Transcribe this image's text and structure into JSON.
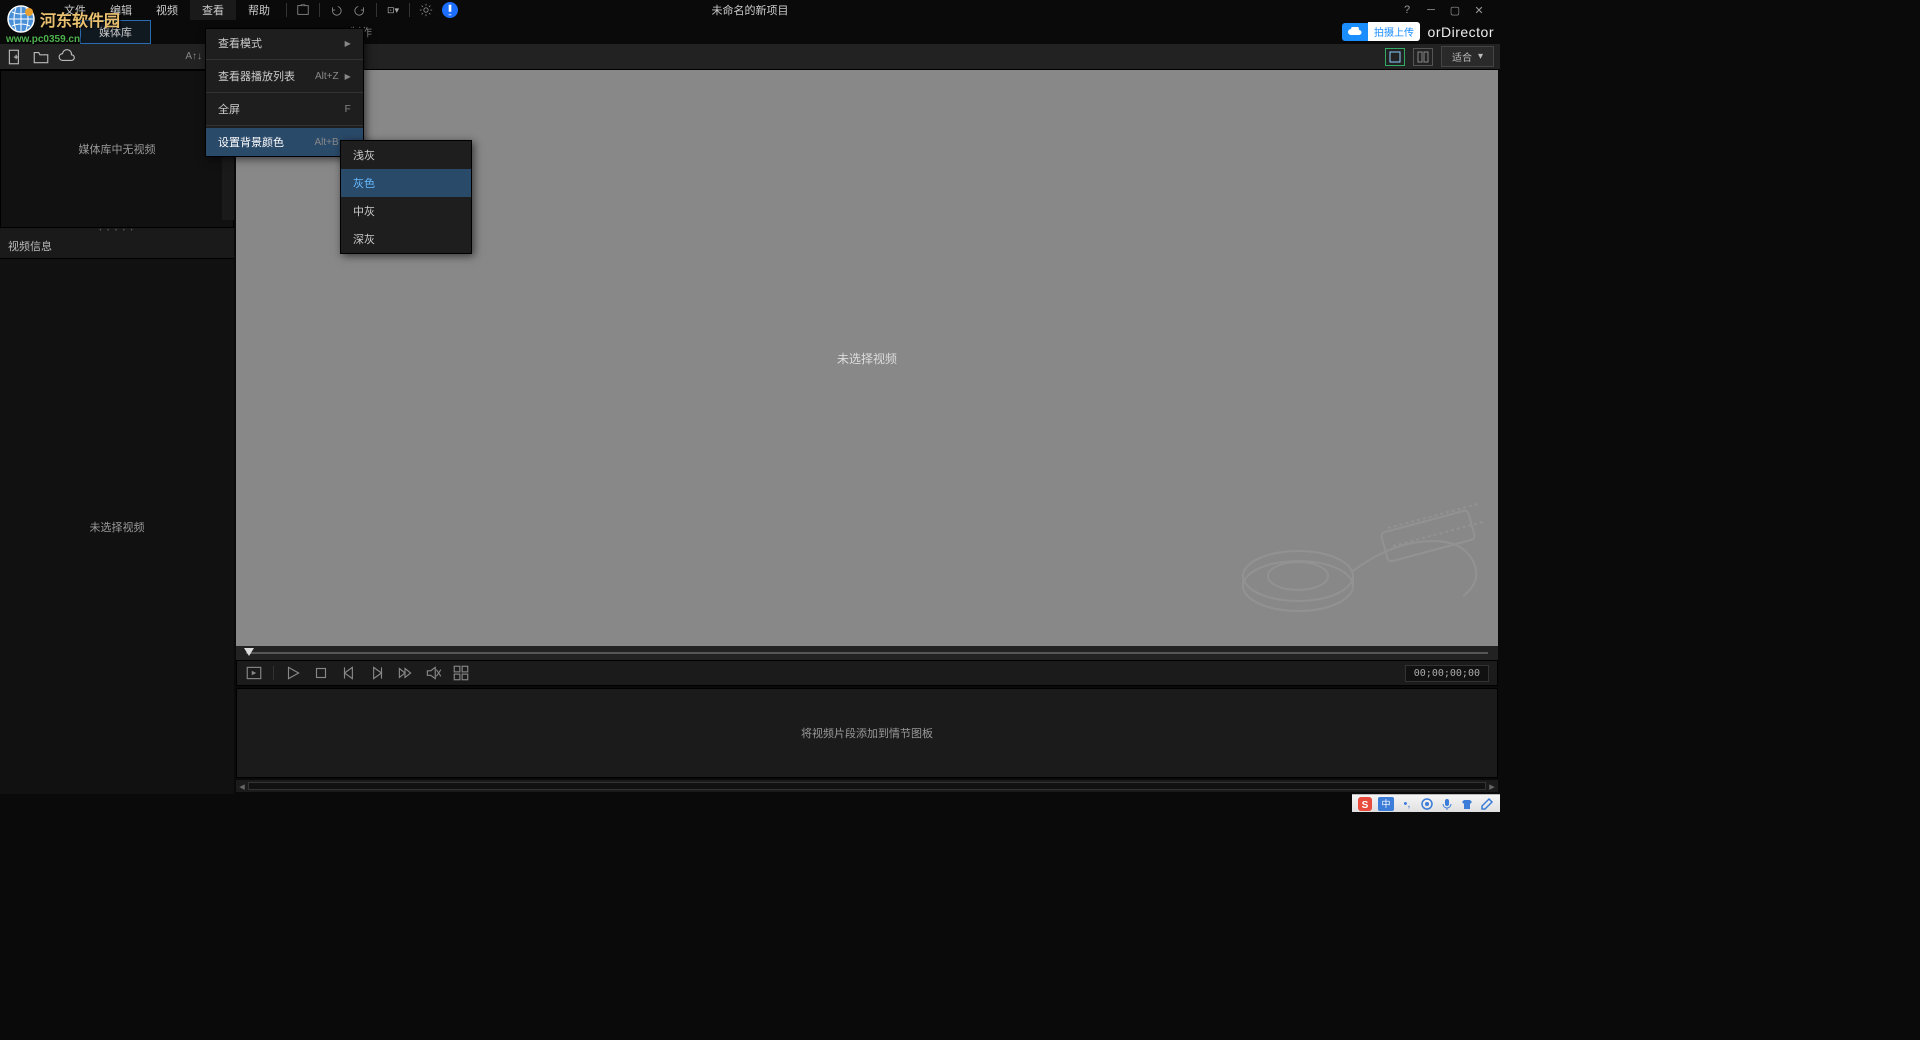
{
  "watermark": {
    "site_name": "河东软件园",
    "url": "www.pc0359.cn"
  },
  "menubar": {
    "items": [
      "文件",
      "编辑",
      "视频",
      "查看",
      "帮助"
    ],
    "title": "未命名的新项目",
    "help_icon": "?"
  },
  "tabs": {
    "media": "媒体库",
    "production": "制作"
  },
  "upload": {
    "label": "拍摄上传"
  },
  "brand": "orDirector",
  "sec_toolbar": {
    "sort_label": "A↑↓",
    "zoom_label": "适合"
  },
  "left_panel": {
    "media_empty": "媒体库中无视频",
    "info_header": "视频信息",
    "info_empty": "未选择视频"
  },
  "viewer": {
    "empty_text": "未选择视频"
  },
  "playbar": {
    "timecode": "00;00;00;00"
  },
  "storyboard": {
    "hint": "将视频片段添加到情节图板"
  },
  "view_menu": {
    "mode": "查看模式",
    "playlist": {
      "label": "查看器播放列表",
      "shortcut": "Alt+Z"
    },
    "fullscreen": {
      "label": "全屏",
      "shortcut": "F"
    },
    "bgcolor": {
      "label": "设置背景颜色",
      "shortcut": "Alt+B"
    }
  },
  "bg_submenu": {
    "items": [
      "浅灰",
      "灰色",
      "中灰",
      "深灰"
    ],
    "selected": "灰色"
  },
  "taskbar": {
    "ime": "中"
  }
}
